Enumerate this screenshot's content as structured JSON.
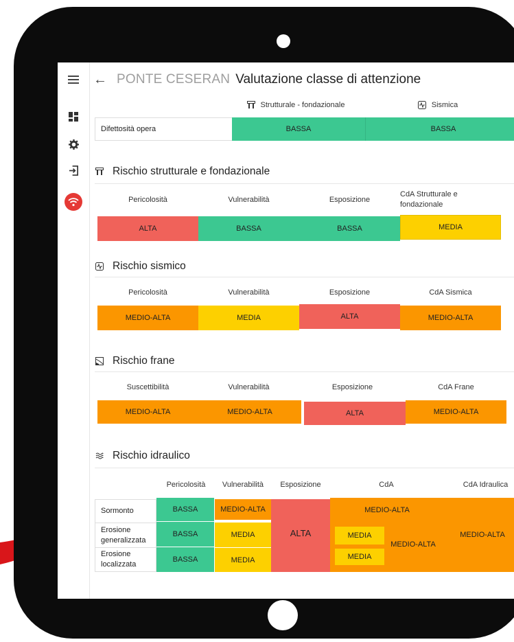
{
  "app": {
    "bridge_name": "PONTE CESERAN",
    "page_title": "Valutazione classe di attenzione"
  },
  "nav": {
    "items": [
      {
        "icon": "menu-icon"
      },
      {
        "icon": "dashboard-icon"
      },
      {
        "icon": "gear-icon"
      },
      {
        "icon": "logout-icon"
      },
      {
        "icon": "wifi-icon"
      }
    ]
  },
  "colors": {
    "BASSA": "#3cc891",
    "MEDIA": "#fdd000",
    "MEDIO-ALTA": "#fb9600",
    "ALTA": "#f0625a"
  },
  "defects": {
    "col_strutturale": "Strutturale - fondazionale",
    "col_sismica": "Sismica",
    "row_label": "Difettosità opera",
    "strutturale": "BASSA",
    "sismica": "BASSA"
  },
  "strutturale": {
    "title": "Rischio strutturale e fondazionale",
    "headers": [
      "Pericolosità",
      "Vulnerabilità",
      "Esposizione",
      "CdA Strutturale e fondazionale"
    ],
    "values": [
      "ALTA",
      "BASSA",
      "BASSA",
      "MEDIA"
    ]
  },
  "sismico": {
    "title": "Rischio sismico",
    "headers": [
      "Pericolosità",
      "Vulnerabilità",
      "Esposizione",
      "CdA Sismica"
    ],
    "values": [
      "MEDIO-ALTA",
      "MEDIA",
      "ALTA",
      "MEDIO-ALTA"
    ]
  },
  "frane": {
    "title": "Rischio frane",
    "headers": [
      "Suscettibilità",
      "Vulnerabilità",
      "Esposizione",
      "CdA Frane"
    ],
    "values": [
      "MEDIO-ALTA",
      "MEDIO-ALTA",
      "ALTA",
      "MEDIO-ALTA"
    ]
  },
  "idraulico": {
    "title": "Rischio idraulico",
    "headers": [
      "Pericolosità",
      "Vulnerabilità",
      "Esposizione",
      "CdA",
      "CdA Idraulica"
    ],
    "rows": [
      {
        "label": "Sormonto",
        "pericolosita": "BASSA",
        "vulnerabilita": "MEDIO-ALTA"
      },
      {
        "label": "Erosione generalizzata",
        "pericolosita": "BASSA",
        "vulnerabilita": "MEDIA"
      },
      {
        "label": "Erosione localizzata",
        "pericolosita": "BASSA",
        "vulnerabilita": "MEDIA"
      }
    ],
    "esposizione": "ALTA",
    "cda_sormonto": "MEDIO-ALTA",
    "cda_gen": "MEDIA",
    "cda_loc": "MEDIA",
    "cda_erosione": "MEDIO-ALTA",
    "cda_idraulica": "MEDIO-ALTA"
  }
}
